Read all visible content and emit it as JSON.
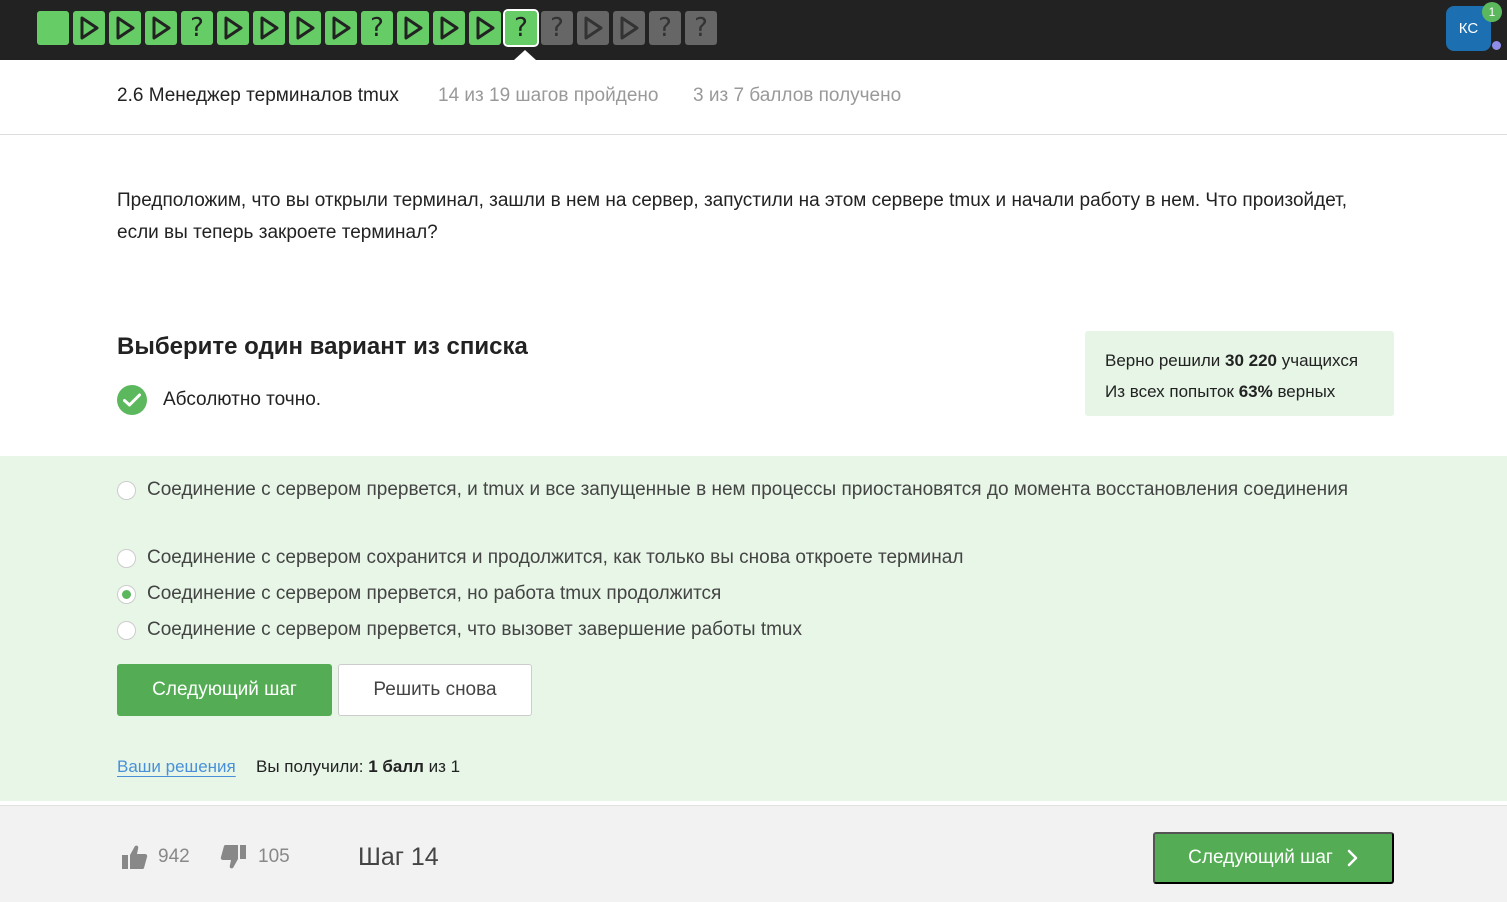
{
  "step_bar": {
    "steps": [
      {
        "state": "done",
        "icon": "square"
      },
      {
        "state": "done",
        "icon": "play-icon"
      },
      {
        "state": "done",
        "icon": "play-icon"
      },
      {
        "state": "done",
        "icon": "play-icon"
      },
      {
        "state": "done",
        "icon": "question-icon"
      },
      {
        "state": "done",
        "icon": "play-icon"
      },
      {
        "state": "done",
        "icon": "play-icon"
      },
      {
        "state": "done",
        "icon": "play-icon"
      },
      {
        "state": "done",
        "icon": "play-icon"
      },
      {
        "state": "done",
        "icon": "question-icon"
      },
      {
        "state": "done",
        "icon": "play-icon"
      },
      {
        "state": "done",
        "icon": "play-icon"
      },
      {
        "state": "done",
        "icon": "play-icon"
      },
      {
        "state": "current",
        "icon": "question-icon"
      },
      {
        "state": "todo",
        "icon": "question-icon"
      },
      {
        "state": "todo",
        "icon": "play-icon"
      },
      {
        "state": "todo",
        "icon": "play-icon"
      },
      {
        "state": "todo",
        "icon": "question-icon"
      },
      {
        "state": "todo",
        "icon": "question-icon"
      }
    ],
    "question_glyph": "?"
  },
  "user": {
    "initials": "КС",
    "notification_count": "1"
  },
  "lesson": {
    "title": "2.6 Менеджер терминалов tmux",
    "progress": "14 из 19 шагов пройдено",
    "score": "3 из 7 баллов  получено"
  },
  "question": {
    "text": "Предположим, что вы открыли терминал, зашли в нем на сервер, запустили на этом сервере tmux и начали работу в нем. Что произойдет, если вы теперь закроете терминал?"
  },
  "quiz": {
    "heading": "Выберите один вариант из списка",
    "feedback": "Абсолютно точно.",
    "options": [
      {
        "label": "Соединение с сервером прервется, и tmux и все запущенные в нем процессы приостановятся до момента восстановления соединения",
        "selected": false
      },
      {
        "label": "Соединение с сервером сохранится и продолжится, как только вы снова откроете терминал",
        "selected": false
      },
      {
        "label": "Соединение с сервером прервется, но работа tmux продолжится",
        "selected": true
      },
      {
        "label": "Соединение с сервером прервется, что вызовет завершение работы tmux",
        "selected": false
      }
    ],
    "next_button": "Следующий шаг",
    "retry_button": "Решить снова",
    "solutions_link": "Ваши решения",
    "result_prefix": "Вы получили: ",
    "result_bold": "1 балл",
    "result_suffix": " из 1"
  },
  "stats": {
    "solved_prefix": "Верно решили ",
    "solved_count": "30 220",
    "solved_suffix": " учащихся",
    "attempts_prefix": "Из всех попыток ",
    "attempts_percent": "63%",
    "attempts_suffix": " верных"
  },
  "footer": {
    "likes": "942",
    "dislikes": "105",
    "step_label": "Шаг 14",
    "next_button": "Следующий шаг"
  },
  "colors": {
    "accent_green": "#54ad54",
    "step_done": "#66cc66",
    "step_todo": "#666666",
    "topbar": "#222222",
    "answer_bg": "#e7f6e7",
    "link_blue": "#4a90d9"
  }
}
